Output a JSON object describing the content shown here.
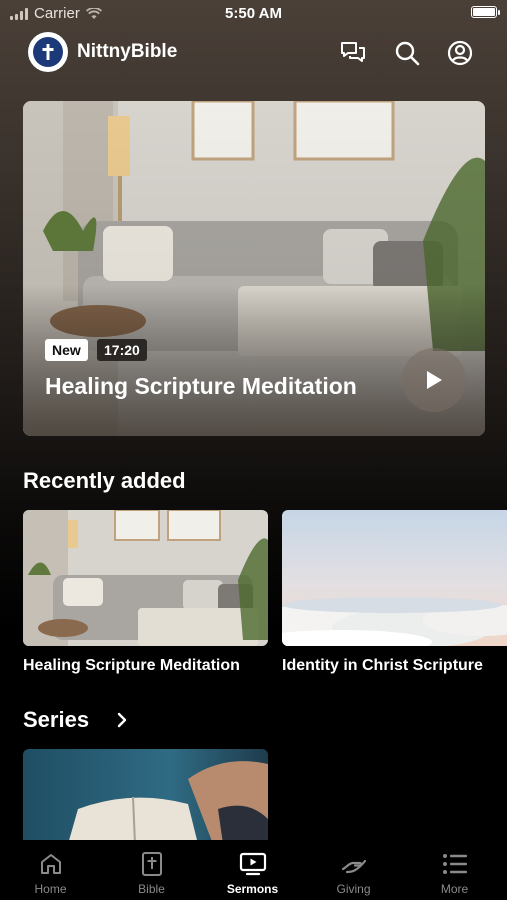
{
  "status_bar": {
    "carrier": "Carrier",
    "time": "5:50 AM"
  },
  "header": {
    "app_name": "NittnyBible"
  },
  "hero": {
    "badge_new": "New",
    "duration": "17:20",
    "title": "Healing Scripture Meditation"
  },
  "recently_added": {
    "title": "Recently added",
    "items": [
      {
        "title": "Healing Scripture Meditation"
      },
      {
        "title": "Identity in Christ Scripture"
      }
    ]
  },
  "series": {
    "title": "Series"
  },
  "tabs": [
    {
      "label": "Home",
      "icon": "home-icon"
    },
    {
      "label": "Bible",
      "icon": "bible-icon"
    },
    {
      "label": "Sermons",
      "icon": "tv-icon",
      "active": true
    },
    {
      "label": "Giving",
      "icon": "giving-hand-icon"
    },
    {
      "label": "More",
      "icon": "menu-icon"
    }
  ],
  "colors": {
    "accent_active": "#ffffff",
    "inactive": "#8a8a8a",
    "background": "#000000"
  }
}
